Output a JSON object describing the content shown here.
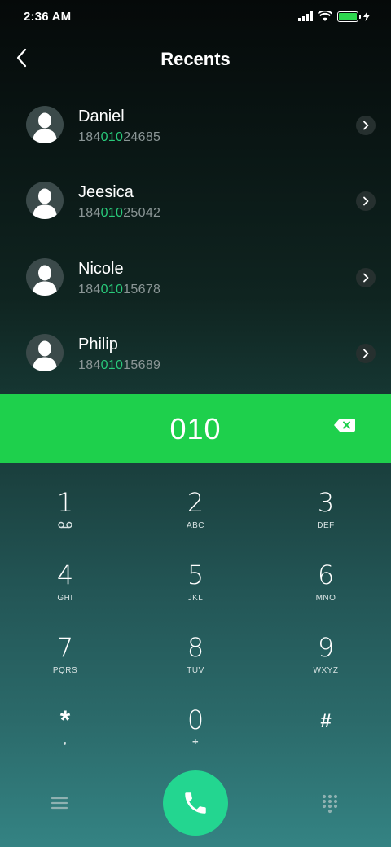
{
  "status_bar": {
    "time": "2:36 AM"
  },
  "header": {
    "title": "Recents"
  },
  "contacts": [
    {
      "name": "Daniel",
      "number_prefix": "184",
      "number_match": "010",
      "number_suffix": "24685"
    },
    {
      "name": "Jeesica",
      "number_prefix": "184",
      "number_match": "010",
      "number_suffix": "25042"
    },
    {
      "name": "Nicole",
      "number_prefix": "184",
      "number_match": "010",
      "number_suffix": "15678"
    },
    {
      "name": "Philip",
      "number_prefix": "184",
      "number_match": "010",
      "number_suffix": "15689"
    }
  ],
  "dial_input": {
    "value": "010"
  },
  "keypad": {
    "k1": {
      "digit": "1",
      "letters": ""
    },
    "k2": {
      "digit": "2",
      "letters": "ABC"
    },
    "k3": {
      "digit": "3",
      "letters": "DEF"
    },
    "k4": {
      "digit": "4",
      "letters": "GHI"
    },
    "k5": {
      "digit": "5",
      "letters": "JKL"
    },
    "k6": {
      "digit": "6",
      "letters": "MNO"
    },
    "k7": {
      "digit": "7",
      "letters": "PQRS"
    },
    "k8": {
      "digit": "8",
      "letters": "TUV"
    },
    "k9": {
      "digit": "9",
      "letters": "WXYZ"
    },
    "kstar": {
      "digit": "*",
      "letters": ","
    },
    "k0": {
      "digit": "0",
      "letters": "+"
    },
    "khash": {
      "digit": "#",
      "letters": ""
    }
  },
  "colors": {
    "accent_green": "#1ed04c",
    "match_highlight": "#29c97a",
    "call_button": "#23d690"
  },
  "icons": {
    "back": "chevron-left-icon",
    "voicemail": "voicemail-icon",
    "backspace": "backspace-icon",
    "call": "phone-icon",
    "menu": "menu-icon",
    "dialpad": "dialpad-icon"
  }
}
